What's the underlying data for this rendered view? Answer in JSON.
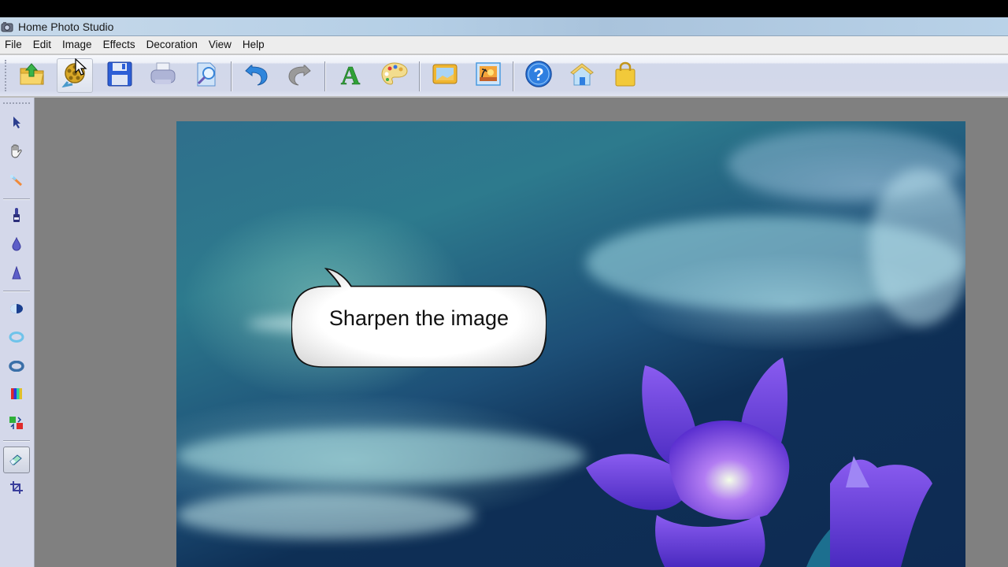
{
  "window": {
    "title": "Home Photo Studio",
    "app_icon": "camera-icon"
  },
  "menu": {
    "items": [
      {
        "label": "File"
      },
      {
        "label": "Edit"
      },
      {
        "label": "Image"
      },
      {
        "label": "Effects"
      },
      {
        "label": "Decoration"
      },
      {
        "label": "View"
      },
      {
        "label": "Help"
      }
    ]
  },
  "toolbar": {
    "buttons": [
      {
        "name": "open",
        "icon": "open-folder-icon"
      },
      {
        "name": "image-effects",
        "icon": "film-reel-icon",
        "hovered": true
      },
      {
        "name": "save",
        "icon": "floppy-disk-icon"
      },
      {
        "name": "print",
        "icon": "printer-icon"
      },
      {
        "name": "print-preview",
        "icon": "magnifier-page-icon"
      },
      {
        "name": "undo",
        "icon": "undo-arrow-icon"
      },
      {
        "name": "redo",
        "icon": "redo-arrow-icon"
      },
      {
        "name": "text",
        "icon": "text-a-icon"
      },
      {
        "name": "color-palette",
        "icon": "palette-icon"
      },
      {
        "name": "frame",
        "icon": "frame-icon"
      },
      {
        "name": "photo",
        "icon": "landscape-photo-icon"
      },
      {
        "name": "help",
        "icon": "question-icon"
      },
      {
        "name": "home",
        "icon": "house-icon"
      },
      {
        "name": "buy",
        "icon": "shopping-bag-icon"
      }
    ]
  },
  "tools": {
    "items": [
      {
        "name": "select",
        "icon": "arrow-pointer-icon"
      },
      {
        "name": "hand",
        "icon": "hand-icon"
      },
      {
        "name": "magic-wand",
        "icon": "magic-wand-icon"
      },
      {
        "name": "brush",
        "icon": "brush-icon"
      },
      {
        "name": "blur-drop",
        "icon": "drop-icon"
      },
      {
        "name": "sharpen",
        "icon": "cone-icon"
      },
      {
        "name": "contrast",
        "icon": "contrast-icon"
      },
      {
        "name": "brightness-ring",
        "icon": "ring-light-icon"
      },
      {
        "name": "darken-ring",
        "icon": "ring-dark-icon"
      },
      {
        "name": "color-bars",
        "icon": "color-bars-icon"
      },
      {
        "name": "replace-color",
        "icon": "replace-color-icon"
      },
      {
        "name": "eraser",
        "icon": "eraser-icon",
        "active": true
      },
      {
        "name": "crop",
        "icon": "crop-icon"
      }
    ]
  },
  "canvas": {
    "image_description": "Purple flowers under a teal night sky with clouds",
    "callout": {
      "text": "Sharpen the image"
    }
  }
}
